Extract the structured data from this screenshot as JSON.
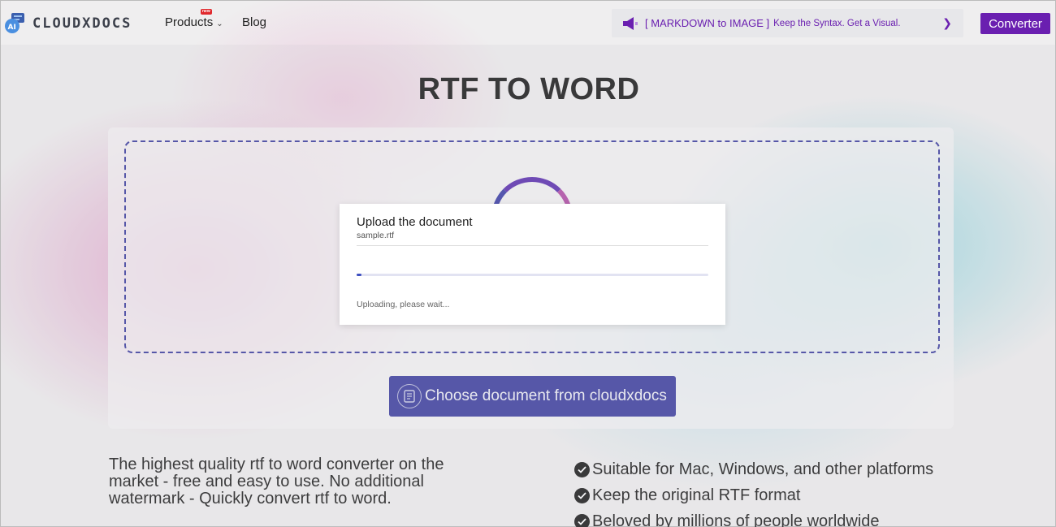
{
  "header": {
    "logo_text": "CLOUDXDOCS",
    "logo_badge": "AI",
    "nav": {
      "products_label": "Products",
      "products_badge": "new",
      "blog_label": "Blog"
    },
    "announcement": {
      "tag": "[ MARKDOWN to IMAGE ]",
      "message": "Keep the Syntax. Get a Visual."
    },
    "converter_label": "Converter"
  },
  "main": {
    "title": "RTF TO WORD",
    "choose_button_label": "Choose document from cloudxdocs"
  },
  "upload_modal": {
    "title": "Upload the document",
    "filename": "sample.rtf",
    "progress_percent": 1.5,
    "status": "Uploading, please wait..."
  },
  "info": {
    "description": "The highest quality rtf to word converter on the market - free and easy to use. No additional watermark - Quickly convert rtf to word.",
    "features": [
      "Suitable for Mac, Windows, and other platforms",
      "Keep the original RTF format",
      "Beloved by millions of people worldwide"
    ]
  },
  "colors": {
    "brand_purple": "#6a1fb0",
    "primary_blue": "#3d3fa0",
    "progress_blue": "#3d4fc0"
  },
  "icons": {
    "logo": "cloudxdocs-logo-icon",
    "speaker": "megaphone-icon",
    "arrow": "arrow-right-icon",
    "choose": "document-icon",
    "check": "check-circle-icon"
  }
}
